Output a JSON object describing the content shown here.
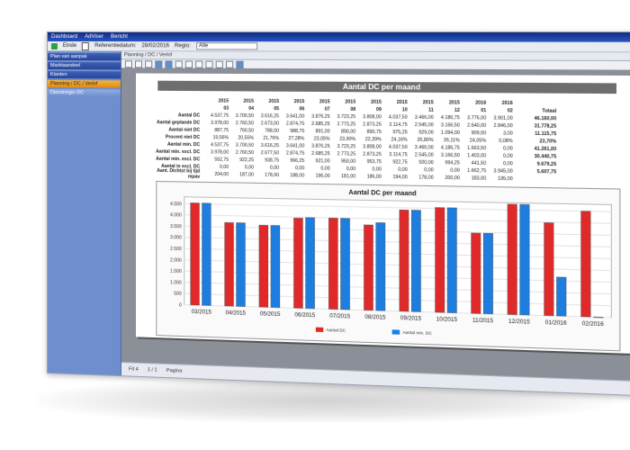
{
  "window": {
    "title_items": [
      "Dashboard",
      "AdViser",
      "Bericht"
    ],
    "toolbar": {
      "close_label": "Einde",
      "refdate_label": "Referentiedatum:",
      "refdate_value": "28/02/2016",
      "region_label": "Regio:",
      "region_value": "Alle"
    }
  },
  "sidebar": {
    "items": [
      {
        "label": "Plan van aanpak",
        "state": "normal"
      },
      {
        "label": "Marktaandeel",
        "state": "normal"
      },
      {
        "label": "Klanten",
        "state": "normal"
      },
      {
        "label": "Planning / DC / Verlof",
        "state": "active"
      },
      {
        "label": "Dienstregio DC",
        "state": "light"
      }
    ]
  },
  "tab": {
    "label": "Planning / DC / Verlof"
  },
  "status": {
    "page": "1 / 1",
    "zoom": "Fit 4",
    "pager_hint": "Pagina"
  },
  "report": {
    "title": "Aantal DC per maand",
    "header_years": [
      "2015",
      "2015",
      "2015",
      "2015",
      "2015",
      "2015",
      "2015",
      "2015",
      "2015",
      "2015",
      "2016",
      "2016"
    ],
    "header_months": [
      "03",
      "04",
      "05",
      "06",
      "07",
      "08",
      "09",
      "10",
      "11",
      "12",
      "01",
      "02"
    ],
    "total_label": "Totaal",
    "rows": [
      {
        "label": "Aantal DC",
        "values": [
          "4.537,75",
          "3.700,50",
          "3.616,25",
          "3.641,00",
          "3.876,25",
          "3.723,25",
          "3.808,00",
          "4.037,50",
          "3.466,00",
          "4.186,75",
          "3.776,00",
          "3.901,00"
        ],
        "total": "46.160,00"
      },
      {
        "label": "Aantal geplande DC",
        "values": [
          "3.978,00",
          "2.760,50",
          "2.673,00",
          "2.874,75",
          "2.685,25",
          "2.773,25",
          "2.873,25",
          "3.114,75",
          "2.545,00",
          "3.166,50",
          "2.640,00",
          "2.846,00"
        ],
        "total": "31.778,25"
      },
      {
        "label": "Aantal niet DC",
        "values": [
          "887,75",
          "760,50",
          "788,00",
          "988,75",
          "891,00",
          "890,00",
          "890,75",
          "975,25",
          "929,00",
          "1.094,00",
          "909,00",
          "3,00"
        ],
        "total": "11.115,75"
      },
      {
        "label": "Procent niet DC",
        "values": [
          "19,56%",
          "20,55%",
          "21,76%",
          "27,28%",
          "23,05%",
          "23,90%",
          "22,39%",
          "24,16%",
          "26,80%",
          "26,11%",
          "24,05%",
          "0,08%"
        ],
        "total": "23,70%"
      },
      {
        "label": "Aantal min. DC",
        "values": [
          "4.537,75",
          "3.700,50",
          "3.616,25",
          "3.641,00",
          "3.876,25",
          "3.723,25",
          "3.808,00",
          "4.037,50",
          "3.466,00",
          "4.186,75",
          "1.663,50",
          "0,00"
        ],
        "total": "41.261,00"
      },
      {
        "label": "Aantal min. excl. DC",
        "values": [
          "3.978,00",
          "2.760,50",
          "2.677,50",
          "2.874,75",
          "2.685,25",
          "2.773,25",
          "2.873,25",
          "3.114,75",
          "2.545,00",
          "3.166,50",
          "1.403,00",
          "0,00"
        ],
        "total": "30.440,75"
      },
      {
        "label": "Aantal min. excl. DC",
        "values": [
          "552,75",
          "922,25",
          "938,75",
          "966,25",
          "921,00",
          "950,00",
          "953,75",
          "922,75",
          "920,00",
          "994,25",
          "441,50",
          "0,00"
        ],
        "total": "9.679,25"
      },
      {
        "label": "Aantal te excl. DC",
        "values": [
          "0,00",
          "0,00",
          "0,00",
          "0,00",
          "0,00",
          "0,00",
          "0,00",
          "0,00",
          "0,00",
          "0,00",
          "1.662,75",
          "3.945,00"
        ],
        "total": "5.607,75"
      },
      {
        "label": "Aant. Dichtst bij tijd mpav",
        "values": [
          "204,00",
          "187,00",
          "178,00",
          "188,00",
          "196,00",
          "181,00",
          "186,00",
          "194,00",
          "178,00",
          "200,00",
          "183,00",
          "195,00"
        ],
        "total": ""
      }
    ]
  },
  "chart_data": {
    "type": "bar",
    "title": "Aantal DC per maand",
    "categories": [
      "03/2015",
      "04/2015",
      "05/2015",
      "06/2015",
      "07/2015",
      "08/2015",
      "09/2015",
      "10/2015",
      "11/2015",
      "12/2015",
      "01/2016",
      "02/2016"
    ],
    "series": [
      {
        "name": "Aantal DC",
        "color": "#e02a2a",
        "values": [
          4537.75,
          3700.5,
          3616.25,
          3960,
          3988,
          3723.25,
          4408,
          4537.5,
          3466,
          4740,
          3976,
          4500
        ]
      },
      {
        "name": "Aantal min. DC",
        "color": "#1e7ee0",
        "values": [
          4537.75,
          3700.5,
          3616.25,
          3988,
          3988,
          3829,
          4408,
          4537.5,
          3466,
          4740,
          1663.5,
          0
        ]
      }
    ],
    "yticks": [
      "0",
      "500",
      "1.000",
      "1.500",
      "2.000",
      "2.500",
      "3.000",
      "3.500",
      "4.000",
      "4.500"
    ],
    "ylim": [
      0,
      4800
    ],
    "grid": true,
    "legend": "bottom"
  }
}
